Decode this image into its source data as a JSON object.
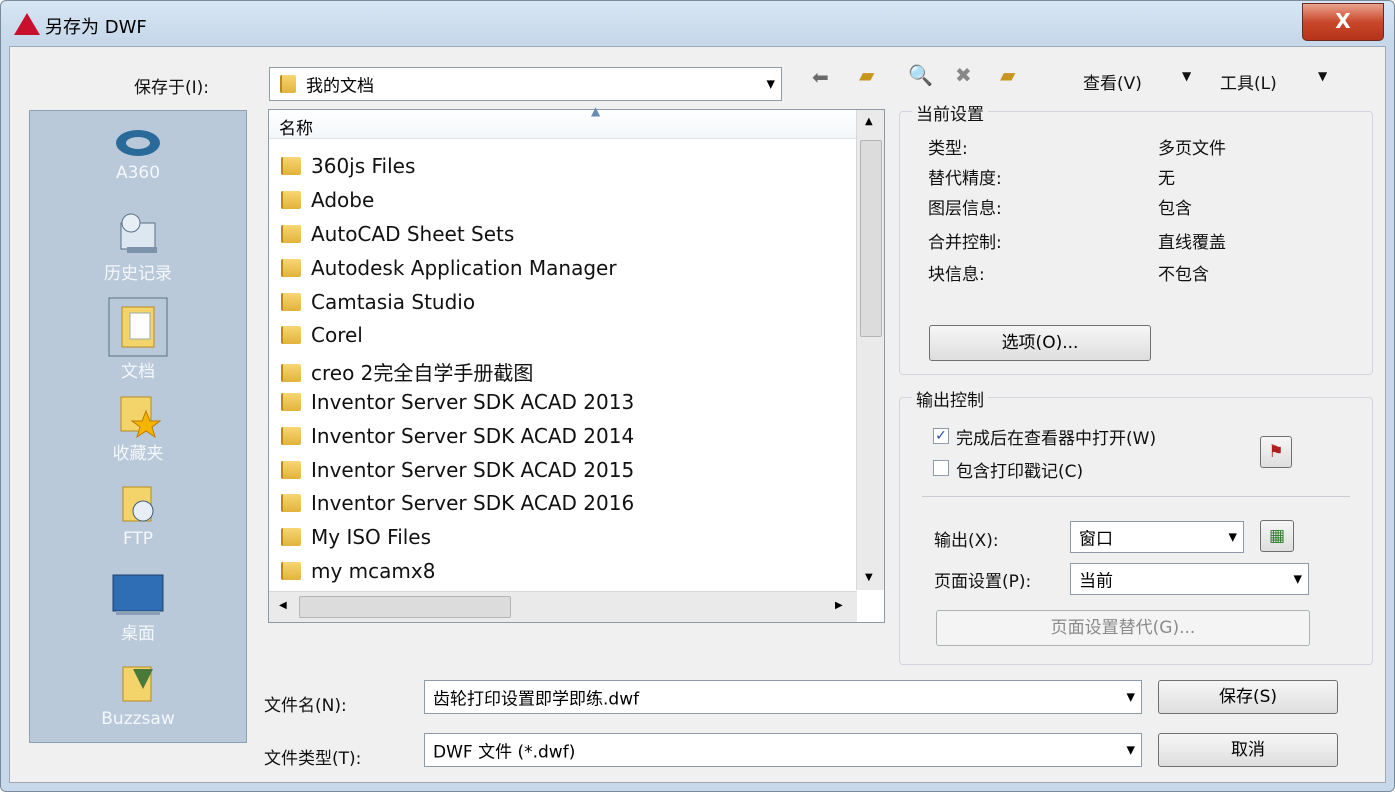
{
  "window": {
    "title": "另存为 DWF",
    "close_label": "X"
  },
  "save_in": {
    "label": "保存于(I):",
    "value": "我的文档"
  },
  "toolbar": {
    "view_label": "查看(V)",
    "tools_label": "工具(L)"
  },
  "places": [
    {
      "label": "A360"
    },
    {
      "label": "历史记录"
    },
    {
      "label": "文档"
    },
    {
      "label": "收藏夹"
    },
    {
      "label": "FTP"
    },
    {
      "label": "桌面"
    },
    {
      "label": "Buzzsaw"
    }
  ],
  "file_list": {
    "column_header": "名称",
    "items": [
      "360js Files",
      "Adobe",
      "AutoCAD Sheet Sets",
      "Autodesk Application Manager",
      "Camtasia Studio",
      "Corel",
      "creo 2完全自学手册截图",
      "Inventor Server SDK ACAD 2013",
      "Inventor Server SDK ACAD 2014",
      "Inventor Server SDK ACAD 2015",
      "Inventor Server SDK ACAD 2016",
      "My ISO Files",
      "my mcamx8"
    ]
  },
  "current_settings": {
    "title": "当前设置",
    "rows": [
      {
        "key": "类型:",
        "value": "多页文件"
      },
      {
        "key": "替代精度:",
        "value": "无"
      },
      {
        "key": "图层信息:",
        "value": "包含"
      },
      {
        "key": "合并控制:",
        "value": "直线覆盖"
      },
      {
        "key": "块信息:",
        "value": "不包含"
      }
    ],
    "options_button": "选项(O)..."
  },
  "output_control": {
    "title": "输出控制",
    "open_in_viewer": {
      "label": "完成后在查看器中打开(W)",
      "checked": true
    },
    "include_stamp": {
      "label": "包含打印戳记(C)",
      "checked": false
    },
    "output": {
      "label": "输出(X):",
      "value": "窗口"
    },
    "page_setup": {
      "label": "页面设置(P):",
      "value": "当前"
    },
    "page_setup_override_button": "页面设置替代(G)..."
  },
  "file_name": {
    "label": "文件名(N):",
    "value": "齿轮打印设置即学即练.dwf"
  },
  "file_type": {
    "label": "文件类型(T):",
    "value": "DWF 文件 (*.dwf)"
  },
  "buttons": {
    "save": "保存(S)",
    "cancel": "取消"
  }
}
